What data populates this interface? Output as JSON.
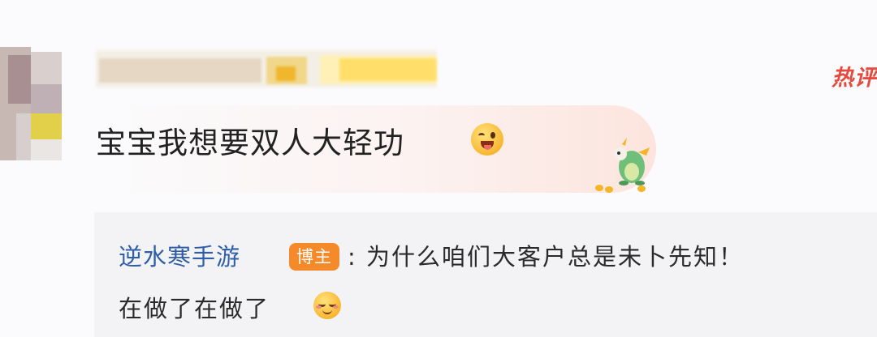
{
  "hot_tag": "热评",
  "comment": {
    "text": "宝宝我想要双人大轻功",
    "emoji": "wink-tongue-emoji"
  },
  "reply": {
    "author": "逆水寒手游",
    "badge": "博主",
    "line1": ": 为什么咱们大客户总是未卜先知！",
    "line2": "在做了在做了",
    "emoji": "smug-emoji"
  },
  "colors": {
    "hot_tag": "#e64a3c",
    "author_link": "#2d5ea7",
    "badge_bg": "#f58a2a",
    "reply_bg": "#f3f3f5"
  }
}
